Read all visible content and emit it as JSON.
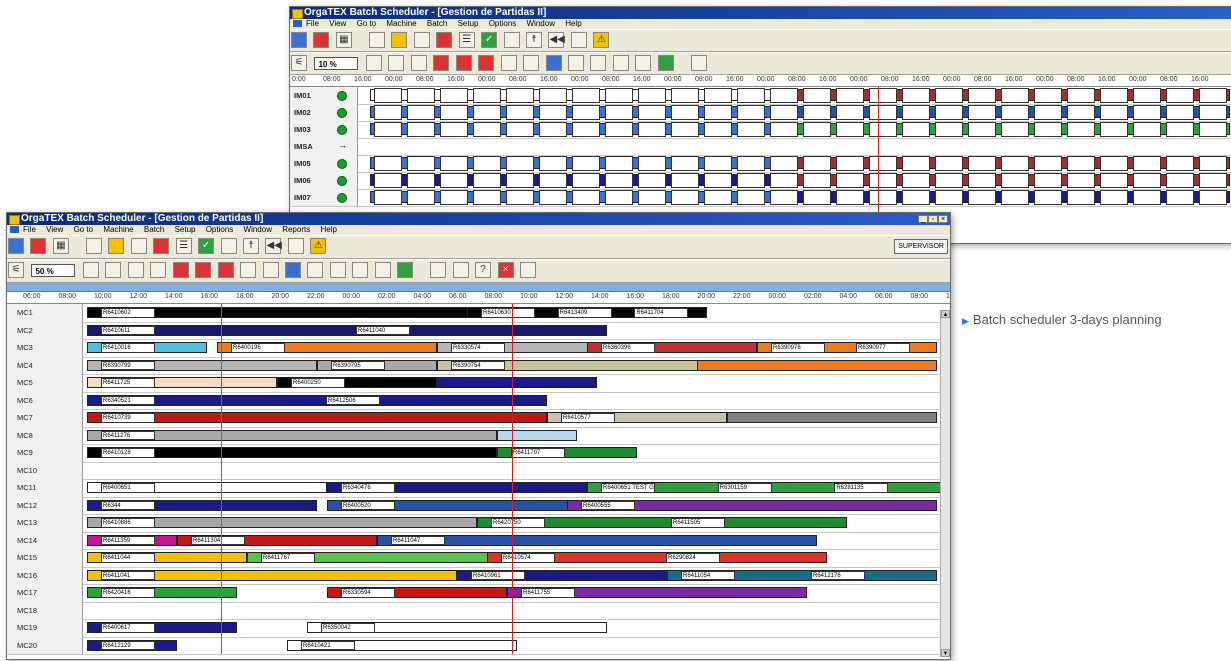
{
  "back_window": {
    "title": "OrgaTEX Batch Scheduler - [Gestion de Partidas II]",
    "menu": [
      "File",
      "View",
      "Go to",
      "Machine",
      "Batch",
      "Setup",
      "Options",
      "Window",
      "Help"
    ],
    "zoom": "10 %",
    "timescale": [
      "0:00",
      "08:00",
      "16:00",
      "00:00",
      "08:00",
      "16:00",
      "00:00",
      "08:00",
      "16:00",
      "00:00",
      "08:00",
      "16:00",
      "00:00",
      "08:00",
      "16:00",
      "00:00",
      "08:00",
      "16:00",
      "00:00",
      "08:00",
      "16:00",
      "00:00",
      "08:00",
      "16:00",
      "00:00",
      "08:00",
      "16:00",
      "00:00",
      "08:00",
      "16:00"
    ],
    "machines": [
      "IM01",
      "IM02",
      "IM03",
      "IMSA",
      "IM05",
      "IM06",
      "IM07"
    ]
  },
  "front_window": {
    "title": "OrgaTEX Batch Scheduler - [Gestion de Partidas II]",
    "menu": [
      "File",
      "View",
      "Go to",
      "Machine",
      "Batch",
      "Setup",
      "Options",
      "Window",
      "Reports",
      "Help"
    ],
    "zoom": "50 %",
    "supervisor_label": "SUPERVISOR",
    "timescale": [
      "06:00",
      "08:00",
      "10:00",
      "12:00",
      "14:00",
      "16:00",
      "18:00",
      "20:00",
      "22:00",
      "00:00",
      "02:00",
      "04:00",
      "06:00",
      "08:00",
      "10:00",
      "12:00",
      "14:00",
      "16:00",
      "18:00",
      "20:00",
      "22:00",
      "00:00",
      "02:00",
      "04:00",
      "06:00",
      "08:00",
      "10:"
    ],
    "machines": [
      "MC1",
      "MC2",
      "MC3",
      "MC4",
      "MC5",
      "MC6",
      "MC7",
      "MC8",
      "MC9",
      "MC10",
      "MC11",
      "MC12",
      "MC13",
      "MC14",
      "MC15",
      "MC16",
      "MC17",
      "MC18",
      "MC19",
      "MC20"
    ],
    "batches": {
      "MC1": [
        "R6410602",
        "R6410630",
        "R6413409",
        "R6411704"
      ],
      "MC2": [
        "R6410611",
        "R6411040"
      ],
      "MC3": [
        "R6410016",
        "R6400196",
        "R6330574",
        "R6360396",
        "R6390976",
        "R6390977"
      ],
      "MC4": [
        "R6390799",
        "R6390795",
        "R6390754"
      ],
      "MC5": [
        "R6411725",
        "R6400250"
      ],
      "MC6": [
        "R6340521",
        "R6412506"
      ],
      "MC7": [
        "R6410739",
        "R6410577"
      ],
      "MC8": [
        "R6411276"
      ],
      "MC9": [
        "R6410128",
        "R6411707"
      ],
      "MC10": [],
      "MC11": [
        "R6400651",
        "R6340476",
        "R6400651 TEST GERARD",
        "R6301159",
        "R6281135"
      ],
      "MC12": [
        "R6344",
        "R6400520",
        "R6400555"
      ],
      "MC13": [
        "R6410886",
        "R6420750",
        "R6411505"
      ],
      "MC14": [
        "R6411359",
        "R6411304",
        "R6411047"
      ],
      "MC15": [
        "R6411044",
        "R6411767",
        "R6410574",
        "R6290824"
      ],
      "MC16": [
        "R6411041",
        "R6410961",
        "R6411054",
        "R6412176"
      ],
      "MC17": [
        "R6420416",
        "R6330594",
        "R6411755"
      ],
      "MC18": [],
      "MC19": [
        "R6400617",
        "R6350042"
      ],
      "MC20": [
        "R6412129",
        "R6410421"
      ]
    }
  },
  "caption": "Batch scheduler 3-days planning"
}
